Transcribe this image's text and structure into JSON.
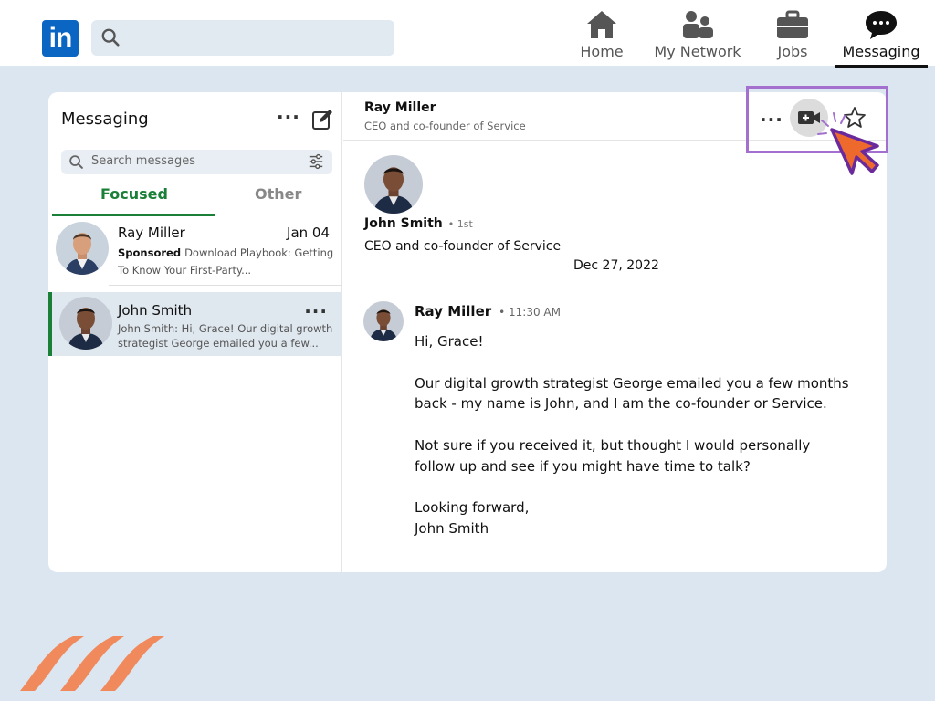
{
  "nav": {
    "logo_text": "in",
    "search_placeholder": "",
    "items": [
      {
        "label": "Home"
      },
      {
        "label": "My Network"
      },
      {
        "label": "Jobs"
      },
      {
        "label": "Messaging"
      }
    ],
    "active": "Messaging"
  },
  "sidebar": {
    "title": "Messaging",
    "search_placeholder": "Search messages",
    "tabs": [
      {
        "label": "Focused"
      },
      {
        "label": "Other"
      }
    ],
    "conversations": [
      {
        "name": "Ray Miller",
        "date": "Jan 04",
        "sponsored_label": "Sponsored",
        "preview": "Download Playbook: Getting To Know Your First-Party..."
      },
      {
        "name": "John Smith",
        "preview": "John Smith: Hi, Grace! Our digital growth strategist George emailed you a few..."
      }
    ]
  },
  "conversation": {
    "header_name": "Ray Miller",
    "header_subtitle": "CEO and co-founder of Service",
    "profile": {
      "name": "John Smith",
      "degree": "• 1st",
      "title": "CEO and co-founder of Service"
    },
    "date_divider": "Dec 27, 2022",
    "message": {
      "sender": "Ray Miller",
      "time": "• 11:30 AM",
      "paragraphs": [
        "Hi, Grace!",
        "Our digital growth strategist George emailed you a few months back - my name is John, and I am the co-founder or Service.",
        "Not sure if you received it, but thought I would personally follow up and see if you might have time to talk?",
        "Looking forward,\nJohn Smith"
      ]
    }
  },
  "colors": {
    "linkedin_blue": "#0a66c2",
    "focused_green": "#1a7f37",
    "highlight_purple": "#a370d0",
    "cursor_orange": "#ee6a2c",
    "brand_orange": "#f08a5d"
  }
}
